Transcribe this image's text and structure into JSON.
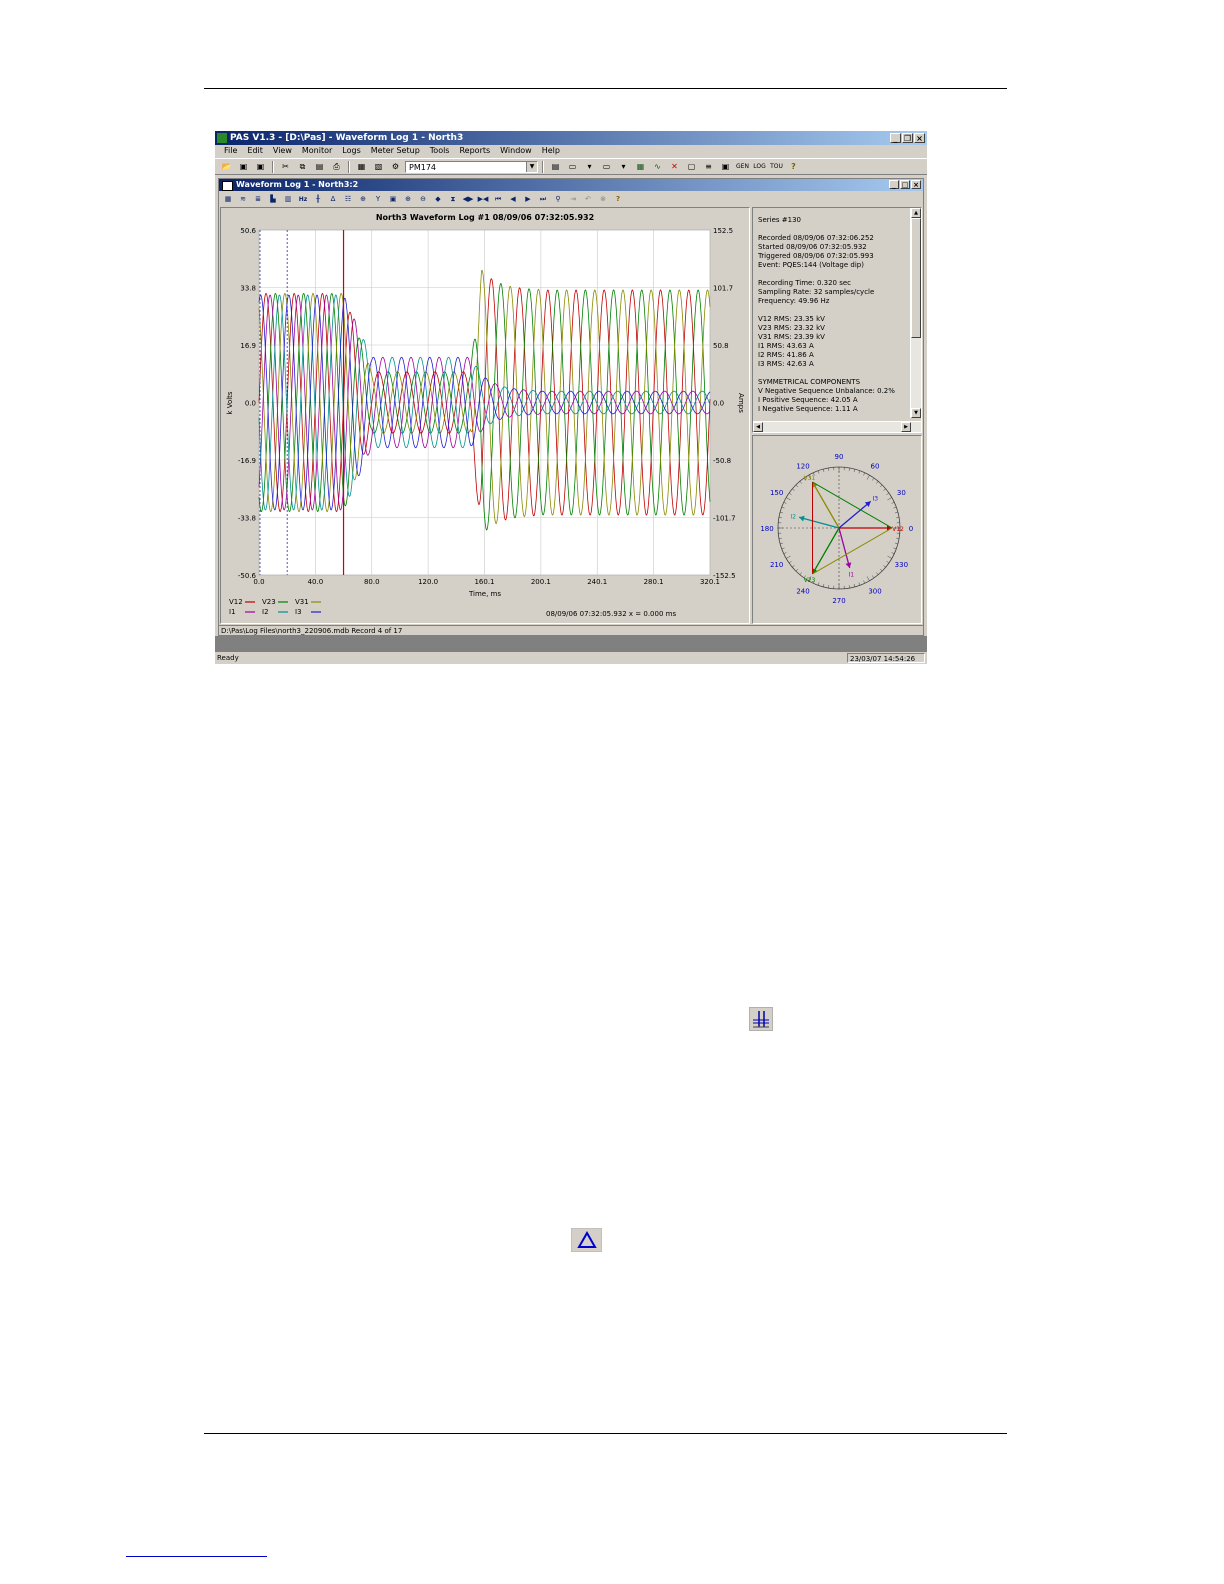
{
  "app": {
    "title": "PAS V1.3 - [D:\\Pas] - Waveform Log 1 - North3",
    "menu": [
      "File",
      "Edit",
      "View",
      "Monitor",
      "Logs",
      "Meter Setup",
      "Tools",
      "Reports",
      "Window",
      "Help"
    ],
    "device_combo": "PM174",
    "toolbar_text_icons": [
      "GEN",
      "LOG",
      "TOU"
    ]
  },
  "child": {
    "title": "Waveform Log 1 - North3:2",
    "hz_label": "Hz",
    "status_path": "D:\\Pas\\Log Files\\north3_220906.mdb  Record 4 of 17"
  },
  "chart_data": {
    "type": "line",
    "title": "North3  Waveform Log #1   08/09/06  07:32:05.932",
    "xlabel": "Time, ms",
    "ylabel": "k Volts",
    "y2label": "Amps",
    "x_ticks": [
      "0.0",
      "40.0",
      "80.0",
      "120.0",
      "160.1",
      "200.1",
      "240.1",
      "280.1",
      "320.1"
    ],
    "y_ticks": [
      "50.6",
      "33.8",
      "16.9",
      "0.0",
      "-16.9",
      "-33.8",
      "-50.6"
    ],
    "y2_ticks": [
      "152.5",
      "101.7",
      "50.8",
      "0.0",
      "-50.8",
      "-101.7",
      "-152.5"
    ],
    "xlim": [
      0,
      320.1
    ],
    "ylim": [
      -50.6,
      50.6
    ],
    "y2lim": [
      -152.5,
      152.5
    ],
    "cursor_x": 60,
    "marker_x": 20,
    "cursor_readout": "08/09/06  07:32:05.932  x = 0.000 ms",
    "series": [
      {
        "name": "V12",
        "color": "#c00000",
        "axis": "v",
        "phase": 0,
        "amp_pre": 32,
        "amp_dip": 9,
        "amp_post": 33
      },
      {
        "name": "V23",
        "color": "#008000",
        "axis": "v",
        "phase": -2.094,
        "amp_pre": 32,
        "amp_dip": 9,
        "amp_post": 33
      },
      {
        "name": "V31",
        "color": "#8a8a00",
        "axis": "v",
        "phase": 2.094,
        "amp_pre": 32,
        "amp_dip": 9,
        "amp_post": 33
      },
      {
        "name": "I1",
        "color": "#a000a0",
        "axis": "i",
        "phase": -0.9,
        "amp_pre": 95,
        "amp_dip": 40,
        "amp_post": 10
      },
      {
        "name": "I2",
        "color": "#009090",
        "axis": "i",
        "phase": -3.0,
        "amp_pre": 95,
        "amp_dip": 40,
        "amp_post": 10
      },
      {
        "name": "I3",
        "color": "#2020d0",
        "axis": "i",
        "phase": 1.2,
        "amp_pre": 95,
        "amp_dip": 40,
        "amp_post": 10
      }
    ]
  },
  "info": {
    "lines": [
      "Series #130",
      "",
      "Recorded 08/09/06  07:32:06.252",
      "Started     08/09/06  07:32:05.932",
      "Triggered  08/09/06  07:32:05.993",
      "Event: PQES:144 (Voltage dip)",
      "",
      "Recording Time: 0.320 sec",
      "Sampling Rate: 32 samples/cycle",
      "Frequency: 49.96 Hz",
      "",
      "V12 RMS: 23.35 kV",
      "V23 RMS: 23.32 kV",
      "V31 RMS: 23.39 kV",
      "I1 RMS: 43.63 A",
      "I2 RMS: 41.86 A",
      "I3 RMS: 42.63 A",
      "",
      "SYMMETRICAL COMPONENTS",
      "V Negative Sequence Unbalance: 0.2%",
      "I Positive Sequence: 42.05 A",
      "I Negative Sequence: 1.11 A"
    ]
  },
  "phasor": {
    "angle_labels": [
      "0",
      "30",
      "60",
      "90",
      "120",
      "150",
      "180",
      "210",
      "240",
      "270",
      "300",
      "330"
    ],
    "vectors": [
      {
        "name": "V12",
        "angle": 0,
        "mag": 1.0,
        "color": "#c00000"
      },
      {
        "name": "V23",
        "angle": 240,
        "mag": 1.0,
        "color": "#008000"
      },
      {
        "name": "V31",
        "angle": 120,
        "mag": 1.0,
        "color": "#8a8a00"
      },
      {
        "name": "I1",
        "angle": 285,
        "mag": 0.78,
        "color": "#a000a0"
      },
      {
        "name": "I2",
        "angle": 165,
        "mag": 0.78,
        "color": "#009090"
      },
      {
        "name": "I3",
        "angle": 40,
        "mag": 0.78,
        "color": "#2020d0"
      }
    ]
  },
  "status": {
    "text": "Ready",
    "datetime": "23/03/07 14:54:26"
  }
}
